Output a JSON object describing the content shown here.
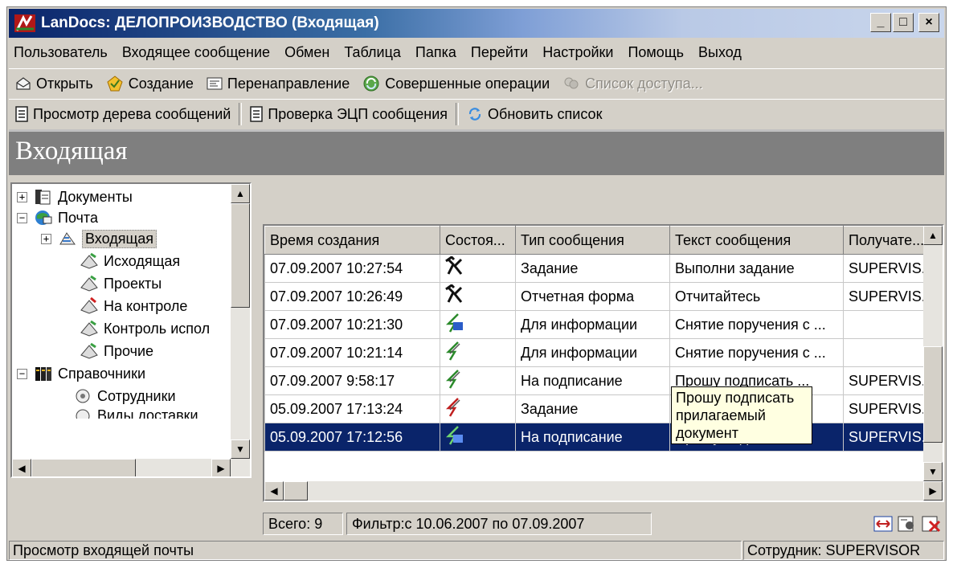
{
  "window": {
    "title": "LanDocs: ДЕЛОПРОИЗВОДСТВО (Входящая)",
    "minimize": "_",
    "maximize": "□",
    "close": "×"
  },
  "menu": [
    "Пользователь",
    "Входящее сообщение",
    "Обмен",
    "Таблица",
    "Папка",
    "Перейти",
    "Настройки",
    "Помощь",
    "Выход"
  ],
  "toolbar1": {
    "open": "Открыть",
    "create": "Создание",
    "redirect": "Перенаправление",
    "operations": "Совершенные операции",
    "access_list": "Список доступа..."
  },
  "toolbar2": {
    "tree_view": "Просмотр дерева сообщений",
    "check_sign": "Проверка ЭЦП сообщения",
    "refresh": "Обновить список"
  },
  "header": {
    "title": "Входящая"
  },
  "tree": {
    "documents": "Документы",
    "mail": "Почта",
    "incoming": "Входящая",
    "outgoing": "Исходящая",
    "projects": "Проекты",
    "control": "На контроле",
    "exec_control": "Контроль испол",
    "other": "Прочие",
    "references": "Справочники",
    "employees": "Сотрудники",
    "cut": "Виды доставки"
  },
  "grid": {
    "columns": [
      "Время создания",
      "Состоя...",
      "Тип сообщения",
      "Текст сообщения",
      "Получате..."
    ],
    "rows": [
      {
        "time": "07.09.2007 10:27:54",
        "icon": "task-hammer-icon",
        "type": "Задание",
        "text": "Выполни задание",
        "recipient": "SUPERVIS..."
      },
      {
        "time": "07.09.2007 10:26:49",
        "icon": "task-hammer-icon",
        "type": "Отчетная форма",
        "text": "Отчитайтесь",
        "recipient": "SUPERVIS..."
      },
      {
        "time": "07.09.2007 10:21:30",
        "icon": "lightning-blue-icon",
        "type": "Для информации",
        "text": "Снятие поручения с ...",
        "recipient": ""
      },
      {
        "time": "07.09.2007 10:21:14",
        "icon": "lightning-icon",
        "type": "Для информации",
        "text": "Снятие поручения с ...",
        "recipient": ""
      },
      {
        "time": "07.09.2007 9:58:17",
        "icon": "lightning-icon",
        "type": "На подписание",
        "text": "Прошу подписать ...",
        "recipient": "SUPERVIS..."
      },
      {
        "time": "05.09.2007 17:13:24",
        "icon": "lightning-red-icon",
        "type": "Задание",
        "text": "",
        "recipient": "SUPERVIS..."
      },
      {
        "time": "05.09.2007 17:12:56",
        "icon": "lightning-blue-icon",
        "type": "На подписание",
        "text": "Прошу подписать ...",
        "recipient": "SUPERVIS..."
      }
    ],
    "tooltip": "Прошу подписать прилагаемый документ"
  },
  "grid_status": {
    "total": "Всего: 9",
    "filter": "Фильтр:с 10.06.2007 по 07.09.2007"
  },
  "statusbar": {
    "left": "Просмотр входящей почты",
    "right": "Сотрудник: SUPERVISOR"
  }
}
